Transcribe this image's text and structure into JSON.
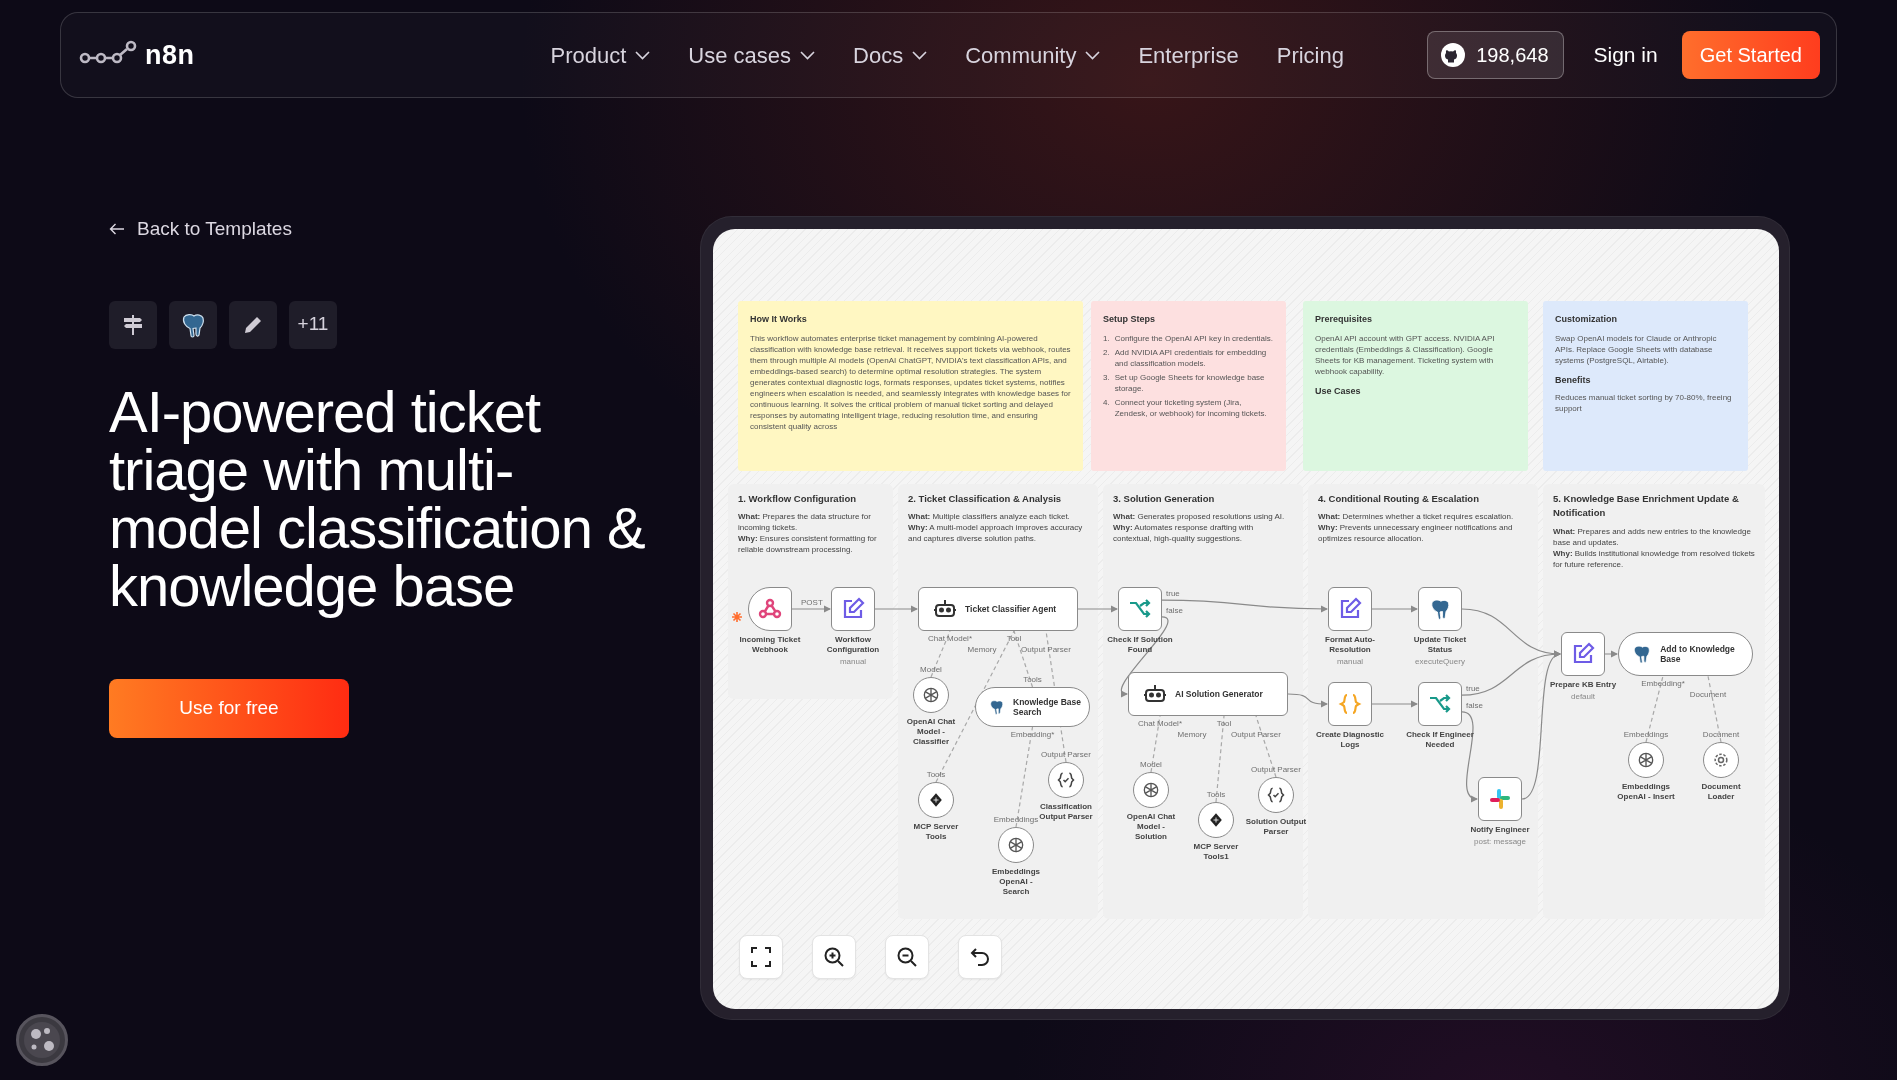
{
  "header": {
    "logo": "n8n",
    "menu": [
      {
        "label": "Product",
        "dropdown": true
      },
      {
        "label": "Use cases",
        "dropdown": true
      },
      {
        "label": "Docs",
        "dropdown": true
      },
      {
        "label": "Community",
        "dropdown": true
      },
      {
        "label": "Enterprise",
        "dropdown": false
      },
      {
        "label": "Pricing",
        "dropdown": false
      }
    ],
    "github_stars": "198,648",
    "sign_in": "Sign in",
    "cta": "Get Started"
  },
  "back_link": "Back to Templates",
  "integrations": {
    "more": "+11"
  },
  "title": "AI-powered ticket triage with multi-model classification & knowledge base",
  "primary_button": "Use for free",
  "canvas": {
    "sticky_notes": [
      {
        "title": "How It Works",
        "color": "#fff7c2",
        "paragraphs": [
          "This workflow automates enterprise ticket management by combining AI-powered classification with knowledge base retrieval. It receives support tickets via webhook, routes them through multiple AI models (OpenAI ChatGPT, NVIDIA's text classification APIs, and embeddings-based search) to determine optimal resolution strategies. The system generates contextual diagnostic logs, formats responses, updates ticket systems, notifies engineers when escalation is needed, and seamlessly integrates with knowledge bases for continuous learning. It solves the critical problem of manual ticket sorting and delayed responses by automating intelligent triage, reducing resolution time, and ensuring consistent quality across"
        ]
      },
      {
        "title": "Setup Steps",
        "color": "#fde0e0",
        "steps": [
          {
            "number": "1.",
            "text": "Configure the OpenAI API key in credentials."
          },
          {
            "number": "2.",
            "text": "Add NVIDIA API credentials for embedding and classification models."
          },
          {
            "number": "3.",
            "text": "Set up Google Sheets for knowledge base storage."
          },
          {
            "number": "4.",
            "text": "Connect your ticketing system (Jira, Zendesk, or webhook) for incoming tickets."
          }
        ]
      },
      {
        "title": "Prerequisites",
        "color": "#dcf7e0",
        "paragraphs": [
          "OpenAI API account with GPT access. NVIDIA API credentials (Embeddings & Classification). Google Sheets for KB management. Ticketing system with webhook capability."
        ],
        "subtitle": "Use Cases"
      },
      {
        "title": "Customization",
        "color": "#dde9fb",
        "paragraphs": [
          "Swap OpenAI models for Claude or Anthropic APIs. Replace Google Sheets with database systems (PostgreSQL, Airtable)."
        ],
        "subtitle": "Benefits",
        "tail": "Reduces manual ticket sorting by 70-80%, freeing support"
      }
    ],
    "sections": [
      {
        "title": "1. Workflow Configuration",
        "lines": [
          "**What:** Prepares the data structure for incoming tickets.",
          "**Why:** Ensures consistent formatting for reliable downstream processing."
        ]
      },
      {
        "title": "2. Ticket Classification & Analysis",
        "lines": [
          "**What:** Multiple classifiers analyze each ticket.",
          "**Why:** A multi-model approach improves accuracy and captures diverse solution paths."
        ]
      },
      {
        "title": "3. Solution Generation",
        "lines": [
          "**What:** Generates proposed resolutions using AI.",
          "**Why:** Automates response drafting with contextual, high-quality suggestions."
        ]
      },
      {
        "title": "4. Conditional Routing & Escalation",
        "lines": [
          "**What:** Determines whether a ticket requires escalation.",
          "**Why:** Prevents unnecessary engineer notifications and optimizes resource allocation."
        ]
      },
      {
        "title": "5. Knowledge Base Enrichment Update & Notification",
        "lines": [
          "**What:** Prepares and adds new entries to the knowledge base and updates.",
          "**Why:** Builds institutional knowledge from resolved tickets for future reference."
        ]
      }
    ],
    "nodes": [
      {
        "label": "Incoming Ticket Webhook",
        "kind": "trigger",
        "output_label": "POST"
      },
      {
        "label": "Workflow Configuration",
        "kind": "action",
        "subtitle": "manual"
      },
      {
        "label": "Ticket Classifier Agent",
        "kind": "agent",
        "ports": [
          "Chat Model*",
          "Memory",
          "Tool",
          "Output Parser"
        ]
      },
      {
        "label": "OpenAI Chat Model - Classifier",
        "kind": "subnode",
        "input_label": "Model"
      },
      {
        "label": "Knowledge Base Search",
        "kind": "tool",
        "input_label": "Tools",
        "ports": [
          "Embedding*"
        ]
      },
      {
        "label": "Classification Output Parser",
        "kind": "subnode",
        "input_label": "Output Parser"
      },
      {
        "label": "MCP Server Tools",
        "kind": "subnode",
        "input_label": "Tools"
      },
      {
        "label": "Embeddings OpenAI - Search",
        "kind": "subnode",
        "input_label": "Embeddings"
      },
      {
        "label": "Check If Solution Found",
        "kind": "action",
        "outputs": [
          "true",
          "false"
        ]
      },
      {
        "label": "AI Solution Generator",
        "kind": "agent",
        "ports": [
          "Chat Model*",
          "Memory",
          "Tool",
          "Output Parser"
        ]
      },
      {
        "label": "OpenAI Chat Model - Solution",
        "kind": "subnode",
        "input_label": "Model"
      },
      {
        "label": "MCP Server Tools1",
        "kind": "subnode",
        "input_label": "Tools"
      },
      {
        "label": "Solution Output Parser",
        "kind": "subnode",
        "input_label": "Output Parser"
      },
      {
        "label": "Format Auto-Resolution",
        "kind": "action",
        "subtitle": "manual"
      },
      {
        "label": "Update Ticket Status",
        "kind": "action",
        "subtitle": "executeQuery"
      },
      {
        "label": "Create Diagnostic Logs",
        "kind": "action"
      },
      {
        "label": "Check If Engineer Needed",
        "kind": "action",
        "outputs": [
          "true",
          "false"
        ]
      },
      {
        "label": "Notify Engineer",
        "kind": "action",
        "subtitle": "post: message"
      },
      {
        "label": "Prepare KB Entry",
        "kind": "action",
        "subtitle": "default"
      },
      {
        "label": "Add to Knowledge Base",
        "kind": "tool",
        "ports": [
          "Embedding*",
          "Document"
        ]
      },
      {
        "label": "Embeddings OpenAI - Insert",
        "kind": "subnode",
        "input_label": "Embeddings"
      },
      {
        "label": "Document Loader",
        "kind": "subnode",
        "input_label": "Document"
      }
    ]
  }
}
